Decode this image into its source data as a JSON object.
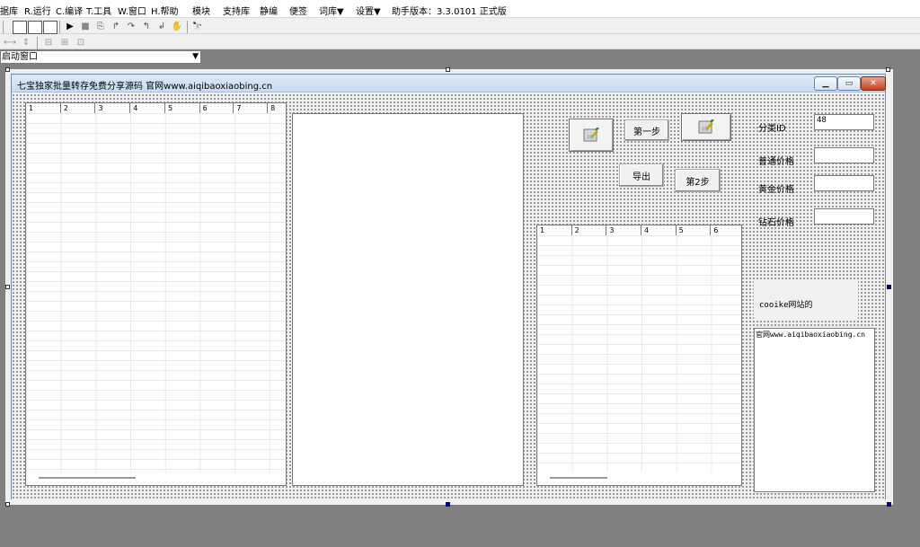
{
  "menu": [
    "据库",
    "R.运行",
    "C.编译",
    "T.工具",
    "W.窗口",
    "H.帮助",
    "模块",
    "支持库",
    "静编",
    "便签",
    "词库▼",
    "设置▼",
    "助手版本：3.3.0101 正式版"
  ],
  "combo": {
    "value": "启动窗口",
    "arrow": "▼"
  },
  "toolbar1": {
    "run": "▶",
    "stop": "■",
    "find": "🔭"
  },
  "form": {
    "title": "七宝独家批量转存免费分享源码  官网www.aiqibaoxiaobing.cn",
    "min_button": "▁",
    "max_button": "▭",
    "close_button": "✕"
  },
  "grid_left": {
    "columns": [
      "1",
      "2",
      "3",
      "4",
      "5",
      "6",
      "7",
      "8"
    ]
  },
  "grid_right": {
    "columns": [
      "1",
      "2",
      "3",
      "4",
      "5",
      "6"
    ]
  },
  "buttons": {
    "step1": "第一步",
    "export": "导出",
    "step2": "第2步"
  },
  "fields": {
    "category_label": "分类ID",
    "category_value": "48",
    "normal_price_label": "普通价格",
    "normal_price_value": "",
    "gold_price_label": "黄金价格",
    "gold_price_value": "",
    "diamond_price_label": "钻石价格",
    "diamond_price_value": ""
  },
  "cookie": {
    "label": "cooike网站的",
    "value": "官网www.aiqibaoxiaobing.cn"
  }
}
